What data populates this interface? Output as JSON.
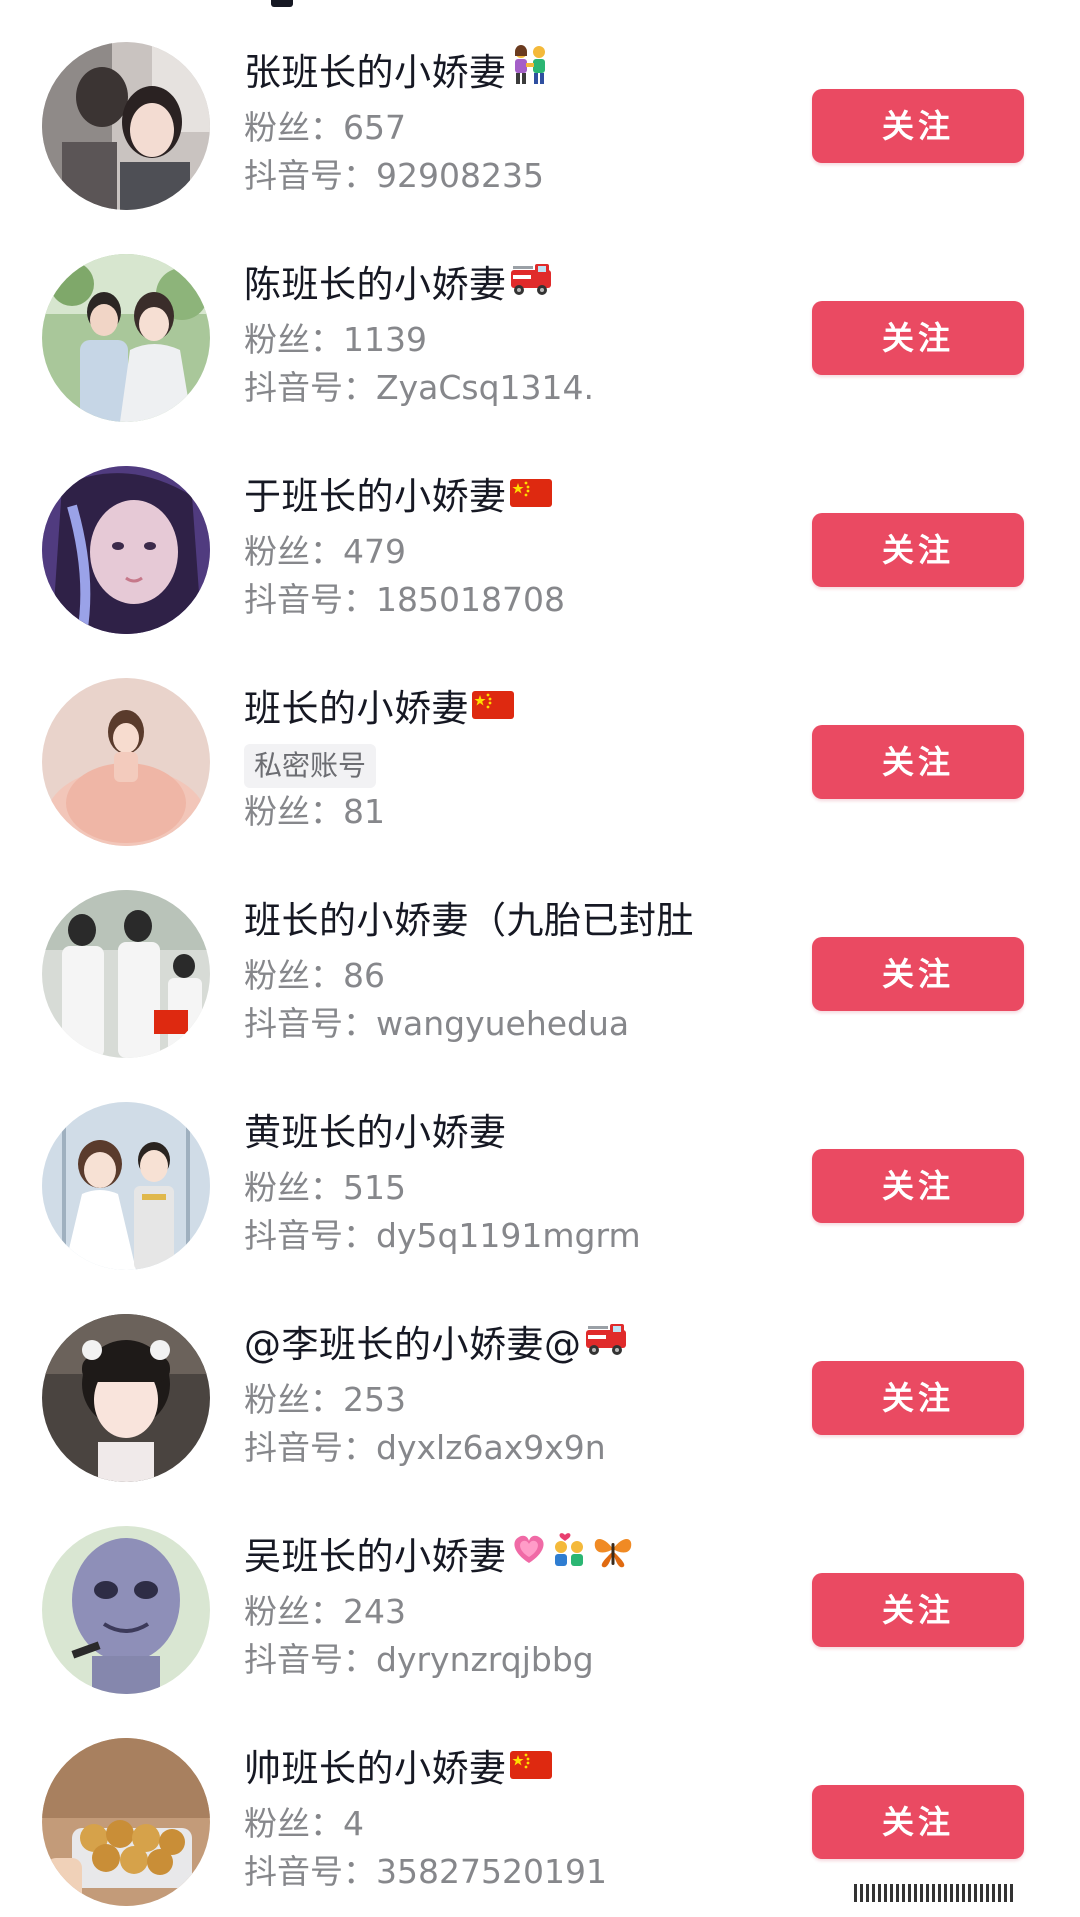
{
  "follow_label": "关注",
  "fans_prefix": "粉丝：",
  "id_prefix": "抖音号：",
  "users": [
    {
      "name": "张班长的小娇妻",
      "emoji": "couple-holding-hands",
      "fans": "657",
      "douyin_id": "92908235"
    },
    {
      "name": "陈班长的小娇妻",
      "emoji": "fire-engine",
      "fans": "1139",
      "douyin_id": "ZyaCsq1314."
    },
    {
      "name": "于班长的小娇妻",
      "emoji": "china-flag",
      "fans": "479",
      "douyin_id": "185018708"
    },
    {
      "name": "班长的小娇妻",
      "emoji": "china-flag",
      "private_tag": "私密账号",
      "fans": "81"
    },
    {
      "name": "班长的小娇妻（九胎已封肚",
      "emoji": "",
      "fans": "86",
      "douyin_id": "wangyuehedua"
    },
    {
      "name": "黄班长的小娇妻",
      "emoji": "",
      "fans": "515",
      "douyin_id": "dy5q1191mgrm"
    },
    {
      "name": "@李班长的小娇妻@",
      "emoji": "fire-engine",
      "fans": "253",
      "douyin_id": "dyxlz6ax9x9n"
    },
    {
      "name": "吴班长的小娇妻",
      "emoji": "heart-couple-butterfly",
      "fans": "243",
      "douyin_id": "dyrynzrqjbbg"
    },
    {
      "name": "帅班长的小娇妻",
      "emoji": "china-flag",
      "fans": "4",
      "douyin_id": "35827520191"
    }
  ],
  "colors": {
    "follow_button": "#ea4a62",
    "name_text": "#161823",
    "meta_text": "#86878b"
  }
}
